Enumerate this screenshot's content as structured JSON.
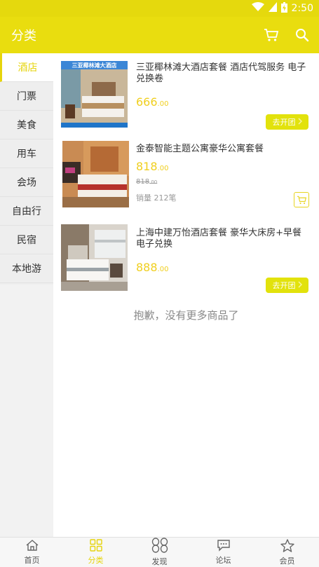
{
  "status_bar": {
    "time": "2:50"
  },
  "header": {
    "title": "分类"
  },
  "sidebar": {
    "items": [
      {
        "label": "酒店"
      },
      {
        "label": "门票"
      },
      {
        "label": "美食"
      },
      {
        "label": "用车"
      },
      {
        "label": "会场"
      },
      {
        "label": "自由行"
      },
      {
        "label": "民宿"
      },
      {
        "label": "本地游"
      }
    ]
  },
  "products": [
    {
      "image_caption": "三亚椰林滩大酒店",
      "name": "三亚椰林滩大酒店套餐 酒店代驾服务 电子兑换卷",
      "price_int": "666",
      "price_dec": ".00",
      "button_label": "去开团"
    },
    {
      "name": "金泰智能主题公寓豪华公寓套餐",
      "price_int": "818",
      "price_dec": ".00",
      "old_price_int": "818",
      "old_price_dec": ".00",
      "sales": "销量 212笔"
    },
    {
      "name": "上海中建万怡酒店套餐 豪华大床房+早餐 电子兑换",
      "price_int": "888",
      "price_dec": ".00",
      "button_label": "去开团"
    }
  ],
  "no_more_text": "抱歉，没有更多商品了",
  "tabbar": {
    "items": [
      {
        "label": "首页",
        "icon": "home-icon"
      },
      {
        "label": "分类",
        "icon": "grid-icon"
      },
      {
        "label": "发现",
        "icon": "discover-icon"
      },
      {
        "label": "论坛",
        "icon": "forum-icon"
      },
      {
        "label": "会员",
        "icon": "star-icon"
      }
    ]
  },
  "colors": {
    "accent": "#e9dd0f",
    "price": "#f0cf1f",
    "button": "#e2e20c"
  }
}
